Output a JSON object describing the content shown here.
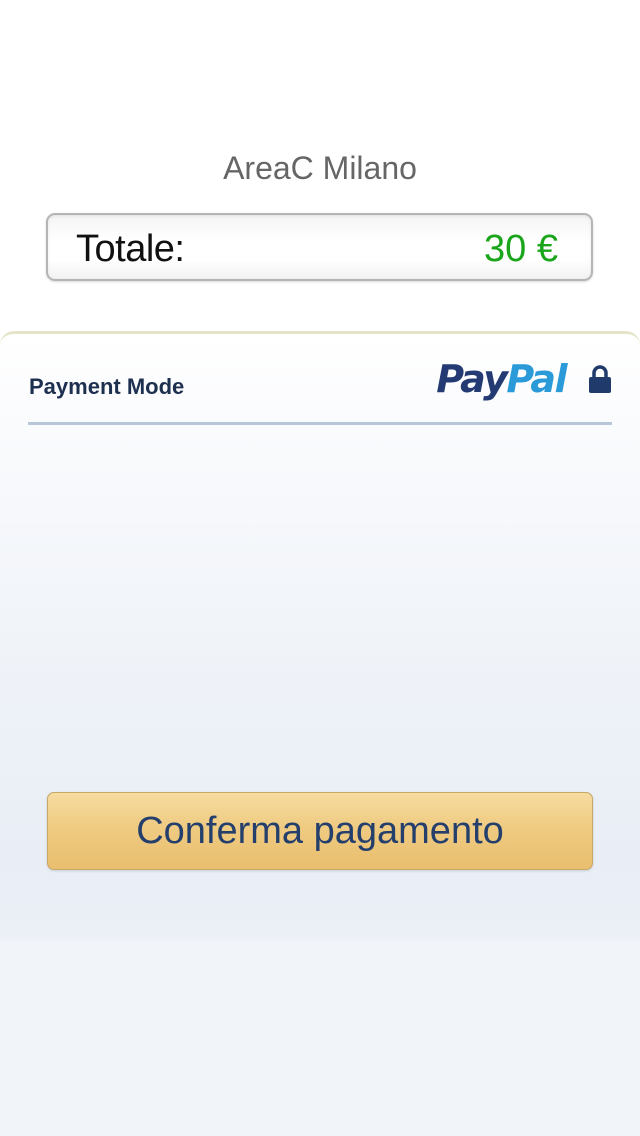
{
  "merchant": {
    "name": "AreaC Milano"
  },
  "total": {
    "label": "Totale:",
    "amount": "30 €",
    "amount_color": "#1aa51a"
  },
  "payment": {
    "mode_label": "Payment Mode",
    "provider_logo": {
      "part1": "Pay",
      "part2": "Pal",
      "color1": "#233a73",
      "color2": "#2a9ad8"
    },
    "lock_icon": "lock-icon",
    "confirm_button_label": "Conferma pagamento"
  }
}
